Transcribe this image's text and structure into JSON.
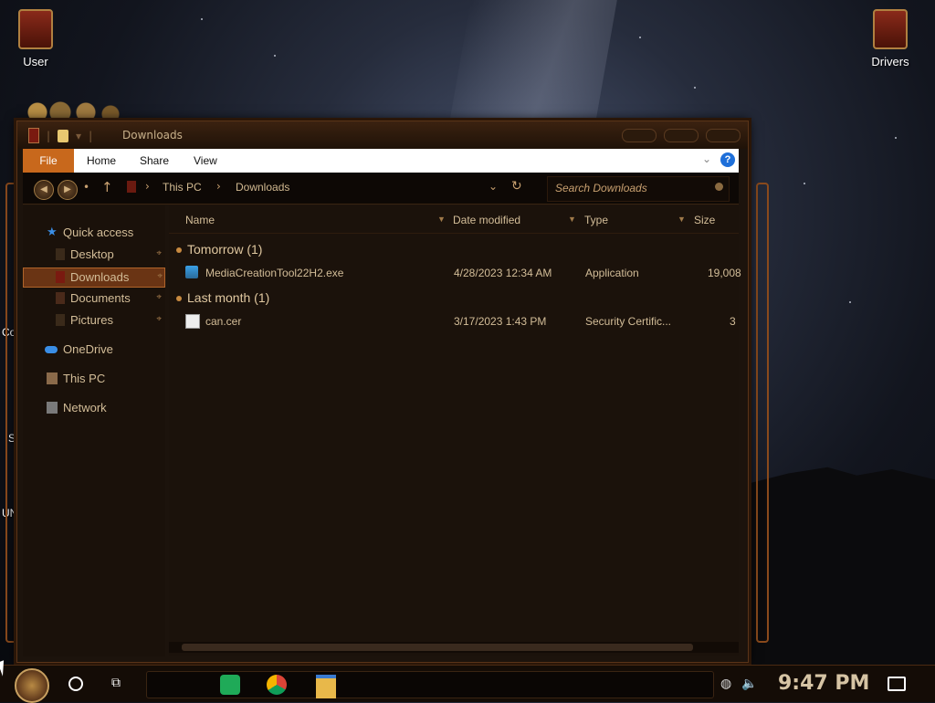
{
  "desktop": {
    "icons": [
      {
        "label": "User"
      },
      {
        "label": "Drivers"
      }
    ],
    "edge_labels": [
      "Co",
      "S",
      "UN"
    ]
  },
  "window": {
    "title": "Downloads",
    "ribbon": {
      "tabs": [
        "File",
        "Home",
        "Share",
        "View"
      ],
      "help": "?"
    },
    "address": {
      "crumbs": [
        "This PC",
        "Downloads"
      ],
      "search_placeholder": "Search Downloads"
    },
    "nav_pane": {
      "items": [
        {
          "label": "Quick access",
          "icon": "star-icon"
        },
        {
          "label": "Desktop",
          "icon": "desktop-folder-icon",
          "pinned": true
        },
        {
          "label": "Downloads",
          "icon": "downloads-folder-icon",
          "pinned": true,
          "selected": true
        },
        {
          "label": "Documents",
          "icon": "documents-folder-icon",
          "pinned": true
        },
        {
          "label": "Pictures",
          "icon": "pictures-folder-icon",
          "pinned": true
        },
        {
          "label": "OneDrive",
          "icon": "cloud-icon"
        },
        {
          "label": "This PC",
          "icon": "computer-icon"
        },
        {
          "label": "Network",
          "icon": "network-icon"
        }
      ]
    },
    "columns": [
      "Name",
      "Date modified",
      "Type",
      "Size"
    ],
    "groups": [
      {
        "label": "Tomorrow (1)",
        "files": [
          {
            "name": "MediaCreationTool22H2.exe",
            "date": "4/28/2023 12:34 AM",
            "type": "Application",
            "size": "19,008",
            "icon": "exe-icon"
          }
        ]
      },
      {
        "label": "Last month (1)",
        "files": [
          {
            "name": "can.cer",
            "date": "3/17/2023 1:43 PM",
            "type": "Security Certific...",
            "size": "3",
            "icon": "certificate-icon"
          }
        ]
      }
    ]
  },
  "taskbar": {
    "pinned": [
      "sheets-icon",
      "chrome-icon",
      "file-explorer-icon"
    ],
    "clock": "9:47 PM"
  },
  "colors": {
    "accent": "#c8681c",
    "selection": "#6a3414",
    "text": "#d3bd98"
  }
}
